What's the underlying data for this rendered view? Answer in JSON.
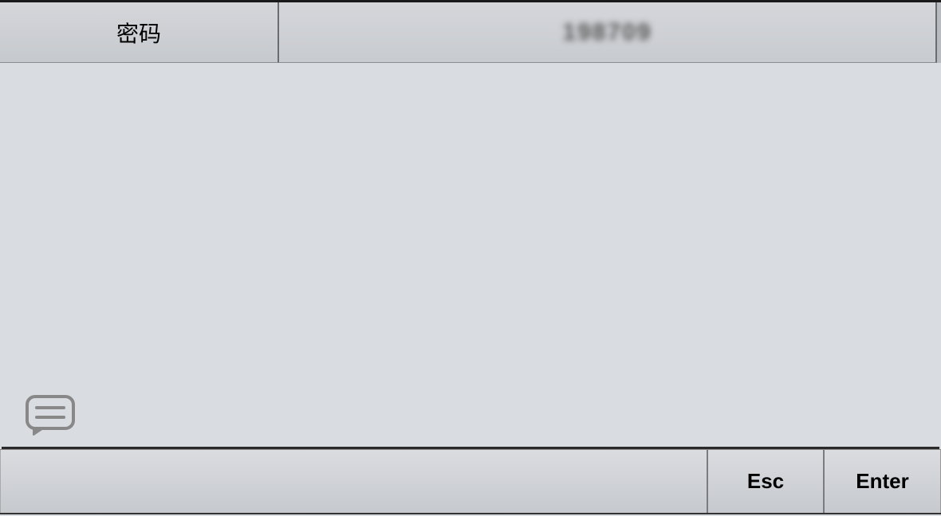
{
  "header": {
    "label": "密码",
    "masked_value": "198709"
  },
  "footer": {
    "esc_label": "Esc",
    "enter_label": "Enter"
  }
}
